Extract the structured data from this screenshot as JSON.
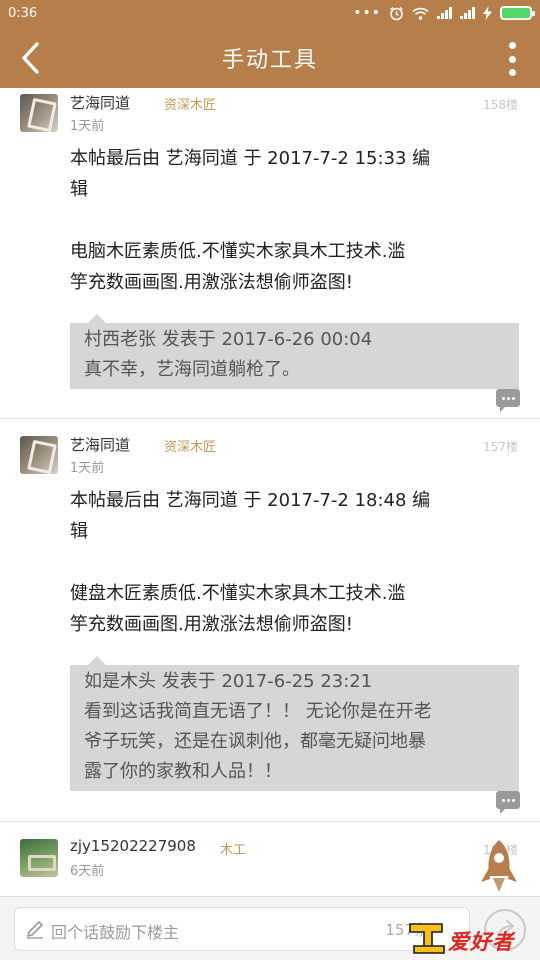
{
  "status_bar": {
    "time": "0:36",
    "icons": [
      "more-dots-icon",
      "alarm-icon",
      "wifi-icon",
      "signal-icon",
      "signal-icon",
      "charging-icon",
      "battery-icon"
    ]
  },
  "header": {
    "title": "手动工具",
    "back_icon": "chevron-left-icon",
    "menu_icon": "more-vertical-icon"
  },
  "posts": [
    {
      "user": "艺海同道",
      "tag": "资深木匠",
      "time": "1天前",
      "floor": "158楼",
      "body": [
        " 本帖最后由 艺海同道 于 2017-7-2 15:33 编",
        "辑",
        "",
        "电脑木匠素质低.不懂实木家具木工技术.滥",
        "竽充数画画图.用激涨法想偷师盗图!"
      ],
      "quote": [
        "村西老张 发表于 2017-6-26 00:04",
        "真不幸，艺海同道躺枪了。"
      ]
    },
    {
      "user": "艺海同道",
      "tag": "资深木匠",
      "time": "1天前",
      "floor": "157楼",
      "body": [
        " 本帖最后由 艺海同道 于 2017-7-2 18:48 编",
        "辑",
        "",
        "健盘木匠素质低.不懂实木家具木工技术.滥",
        "竽充数画画图.用激涨法想偷师盗图!"
      ],
      "quote": [
        "如是木头 发表于 2017-6-25 23:21",
        "看到这话我简直无语了！！ 无论你是在开老",
        "爷子玩笑，还是在讽刺他，都毫无疑问地暴",
        "露了你的家教和人品！！"
      ]
    },
    {
      "user": "zjy15202227908",
      "tag": "木工",
      "time": "6天前",
      "floor": "156楼"
    }
  ],
  "reply_bar": {
    "placeholder": "回个话鼓励下楼主",
    "count": "157条",
    "share_icon": "share-arrow-icon"
  },
  "watermark": {
    "text": "爱好者",
    "logo_text": "木工"
  },
  "colors": {
    "brand": "#b57e4a",
    "tag": "#c49a52",
    "quote_bg": "#d6d6d6",
    "watermark": "#e0231d"
  }
}
